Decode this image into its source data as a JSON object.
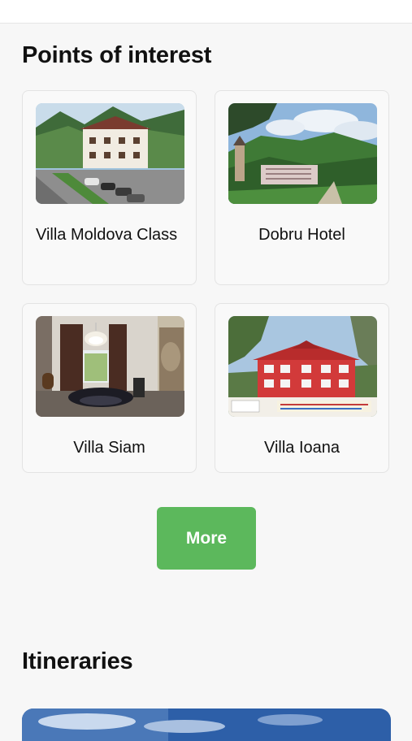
{
  "points_of_interest": {
    "title": "Points of interest",
    "items": [
      {
        "name": "Villa Moldova Class",
        "image": "villa-moldova-class-photo"
      },
      {
        "name": "Dobru Hotel",
        "image": "dobru-hotel-photo"
      },
      {
        "name": "Villa Siam",
        "image": "villa-siam-photo"
      },
      {
        "name": "Villa Ioana",
        "image": "villa-ioana-photo"
      }
    ],
    "more_label": "More"
  },
  "itineraries": {
    "title": "Itineraries"
  },
  "colors": {
    "page_background": "#f7f7f7",
    "card_background": "#f9f9f9",
    "card_border": "#e3e3e3",
    "more_button": "#5cb85c",
    "more_button_text": "#ffffff"
  }
}
